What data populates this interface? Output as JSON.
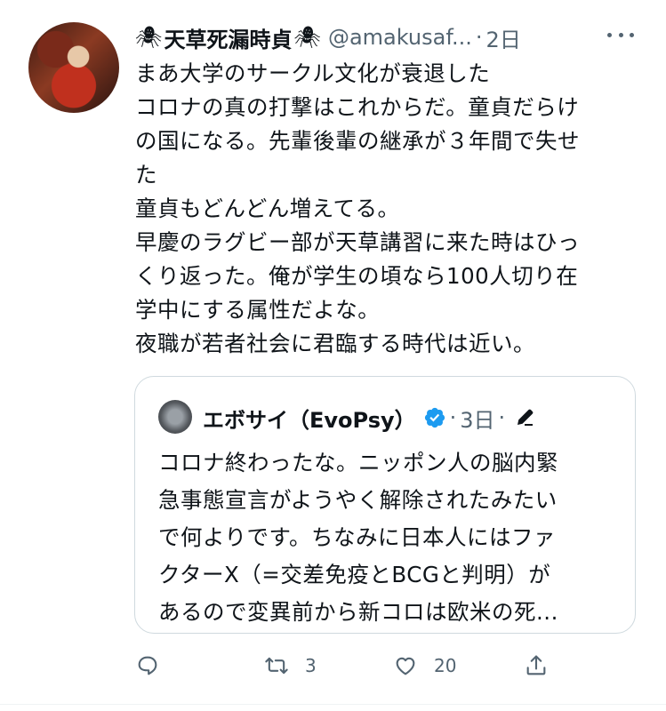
{
  "tweet": {
    "spider_left": "🕷",
    "display_name": "天草死漏時貞",
    "spider_right": "🕷",
    "handle": "@amakusaf...",
    "dot": "·",
    "time": "2日",
    "body_lines": [
      "まあ大学のサークル文化が衰退した",
      "コロナの真の打撃はこれからだ。童貞だらけ",
      "の国になる。先輩後輩の継承が３年間で失せ",
      "た",
      "童貞もどんどん増えてる。",
      "早慶のラグビー部が天草講習に来た時はひっ",
      "くり返った。俺が学生の頃なら100人切り在",
      "学中にする属性だよな。",
      "夜職が若者社会に君臨する時代は近い。"
    ]
  },
  "quote": {
    "display_name": "エボサイ（EvoPsy）",
    "dot": "·",
    "time": "3日",
    "dot2": "·",
    "body_lines": [
      "コロナ終わったな。ニッポン人の脳内緊",
      "急事態宣言がようやく解除されたみたい",
      "で何よりです。ちなみに日本人にはファ",
      "クターX（=交差免疫とBCGと判明）が",
      "あるので変異前から新コロは欧米の死..."
    ]
  },
  "actions": {
    "reply_count": "",
    "retweet_count": "3",
    "like_count": "20"
  },
  "icons": {
    "more": "more-horizontal-icon",
    "verified": "verified-badge-icon",
    "edit": "edit-pencil-icon",
    "reply": "reply-icon",
    "retweet": "retweet-icon",
    "like": "heart-icon",
    "share": "share-icon"
  },
  "colors": {
    "text": "#0f1419",
    "secondary": "#536471",
    "verified": "#1d9bf0",
    "border": "#cfd9de"
  }
}
